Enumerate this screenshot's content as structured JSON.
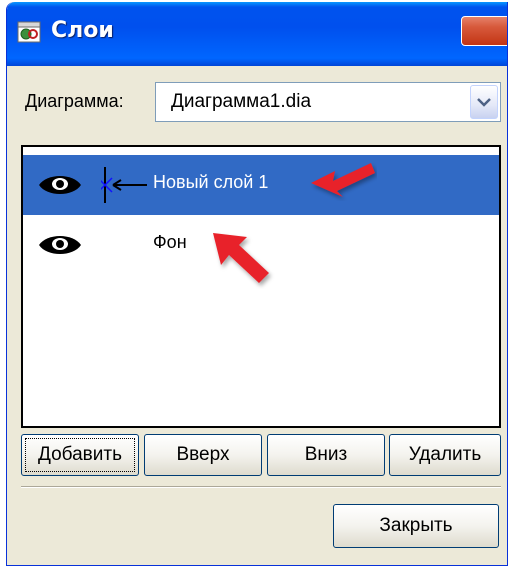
{
  "window": {
    "title": "Слои",
    "icon": "dia-layers-icon"
  },
  "diagram": {
    "label": "Диаграмма:",
    "selected": "Диаграмма1.dia"
  },
  "layers": [
    {
      "name": "Новый слой 1",
      "visible": true,
      "selected": true,
      "connectable": true
    },
    {
      "name": "Фон",
      "visible": true,
      "selected": false,
      "connectable": false
    }
  ],
  "buttons": {
    "add": "Добавить",
    "up": "Вверх",
    "down": "Вниз",
    "delete": "Удалить",
    "close": "Закрыть"
  },
  "colors": {
    "selection": "#316ac5",
    "annotation_arrow": "#e8222a",
    "titlebar": "#0053ee",
    "dialog_bg": "#ece9d8"
  }
}
